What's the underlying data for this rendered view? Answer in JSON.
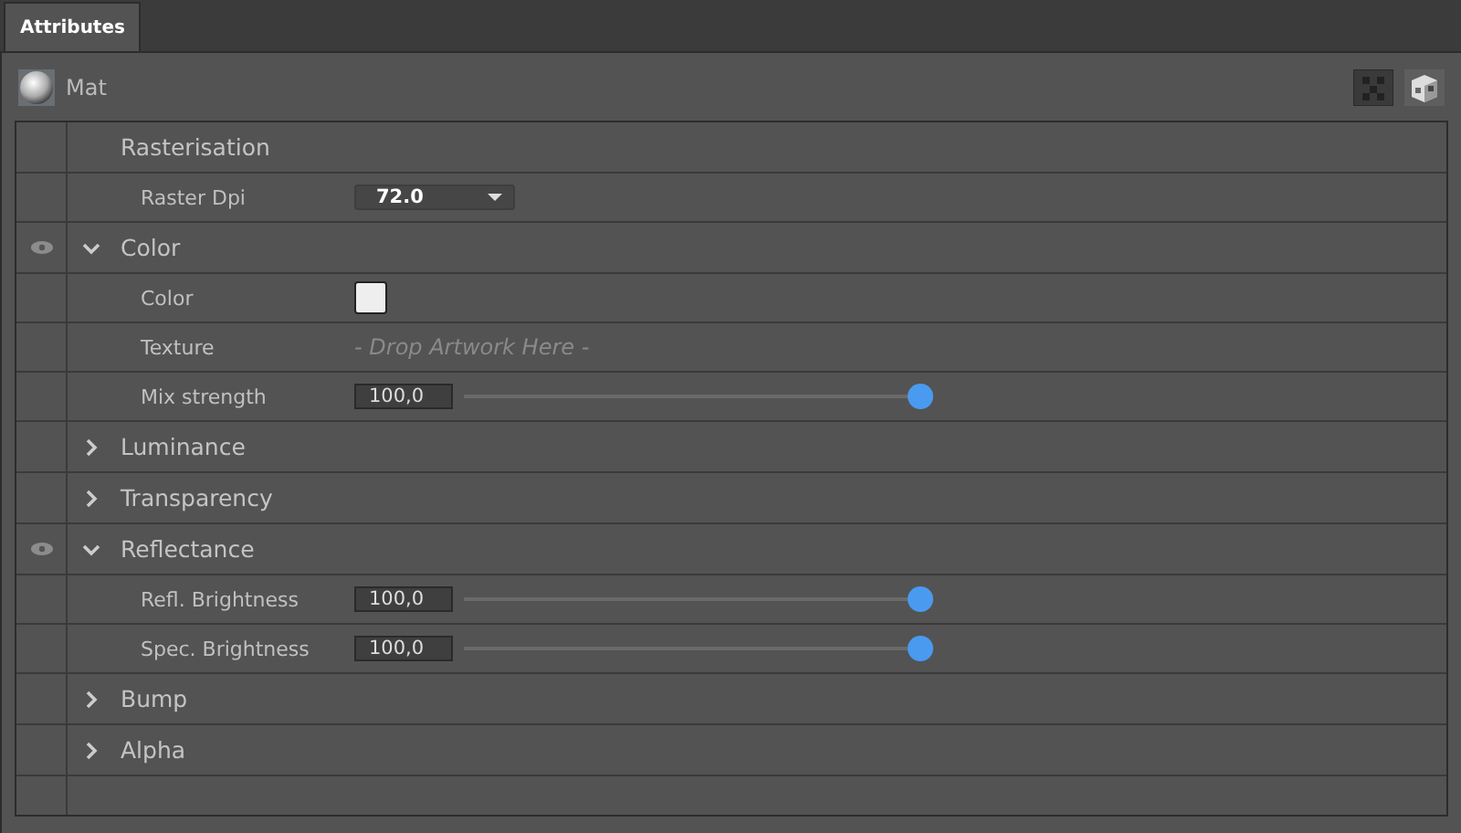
{
  "tabs": [
    {
      "label": "Attributes",
      "selected": true
    }
  ],
  "material": {
    "name": "Mat"
  },
  "sections": [
    {
      "label": "Rasterisation",
      "kind": "heading",
      "visible": false,
      "properties": [
        {
          "kind": "dropdown",
          "label": "Raster Dpi",
          "value": "72.0"
        }
      ]
    },
    {
      "label": "Color",
      "kind": "group",
      "expanded": true,
      "visible": true,
      "properties": [
        {
          "kind": "swatch",
          "label": "Color"
        },
        {
          "kind": "drop",
          "label": "Texture",
          "placeholder": "- Drop Artwork Here -"
        },
        {
          "kind": "slider",
          "label": "Mix strength",
          "value": "100,0",
          "level": 1
        }
      ]
    },
    {
      "label": "Luminance",
      "kind": "group",
      "expanded": false,
      "visible": false
    },
    {
      "label": "Transparency",
      "kind": "group",
      "expanded": false,
      "visible": false
    },
    {
      "label": "Reflectance",
      "kind": "group",
      "expanded": true,
      "visible": true,
      "properties": [
        {
          "kind": "slider",
          "label": "Refl. Brightness",
          "value": "100,0",
          "level": 1
        },
        {
          "kind": "slider",
          "label": "Spec. Brightness",
          "value": "100,0",
          "level": 1
        }
      ]
    },
    {
      "label": "Bump",
      "kind": "group",
      "expanded": false,
      "visible": false
    },
    {
      "label": "Alpha",
      "kind": "group",
      "expanded": false,
      "visible": false
    }
  ]
}
